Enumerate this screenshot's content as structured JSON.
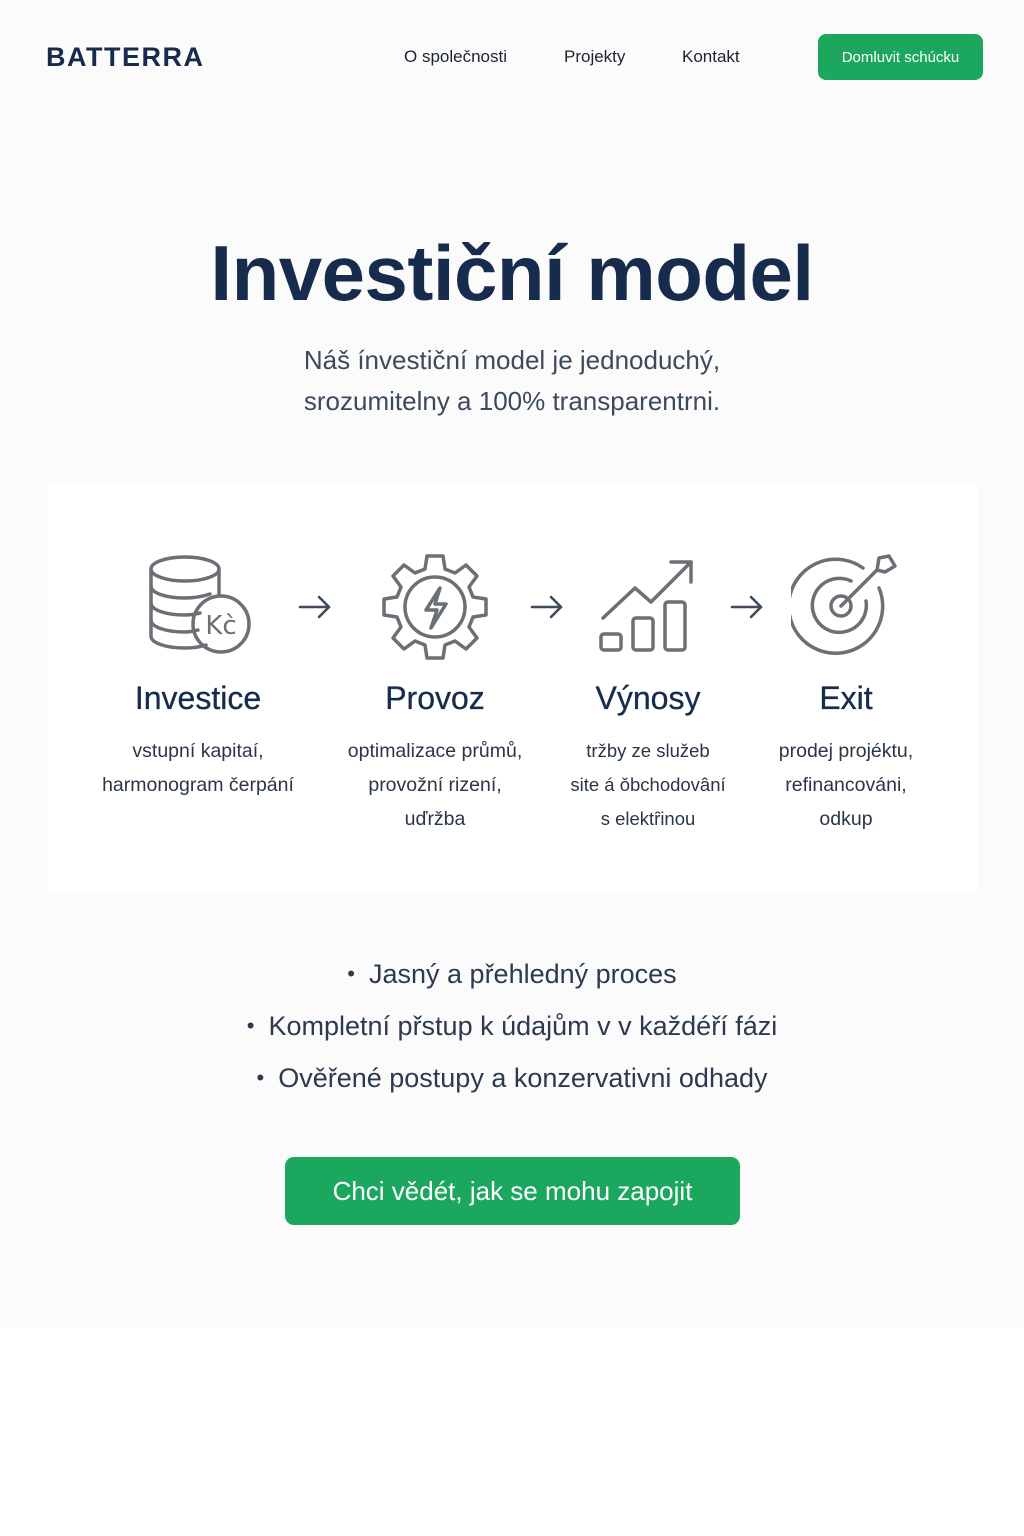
{
  "header": {
    "logo": "BATTERRA",
    "nav": {
      "about": "O společnosti",
      "projects": "Projekty",
      "contact": "Kontakt"
    },
    "cta_label": "Domluvit schúcku"
  },
  "hero": {
    "title": "Investiční model",
    "subtitle_line1": "Náš ínvestiční model je jednoduchý,",
    "subtitle_line2": "srozumitelny a 100% transparentrni."
  },
  "steps": [
    {
      "icon": "coin-stack-icon",
      "icon_text": "Kc̀",
      "title": "Investice",
      "desc": [
        "vstupní kapitaí,",
        "harmonogram čerpání"
      ]
    },
    {
      "icon": "gear-bolt-icon",
      "title": "Provoz",
      "desc": [
        "optimalizace průmů,",
        "provožní rizení,",
        "uďržba"
      ]
    },
    {
      "icon": "growth-chart-icon",
      "title": "Výnosy",
      "desc": [
        "tržby ze služeb",
        "site á ǒbchodovâní",
        "s elektȓinou"
      ]
    },
    {
      "icon": "target-icon",
      "title": "Exit",
      "desc": [
        "prodej projéktu,",
        "refinancováni,",
        "odkup"
      ]
    }
  ],
  "bullets": [
    "Jasný a přehledný proces",
    "Kompletní přstup k údajům v v každéří fázi",
    "Ověřené postupy a konzervativni odhady"
  ],
  "cta_main_label": "Chci vědét, jak se mohu zapojit",
  "colors": {
    "brand_navy": "#172b4d",
    "accent_green": "#1ba75e",
    "icon_gray": "#6b6f76"
  }
}
